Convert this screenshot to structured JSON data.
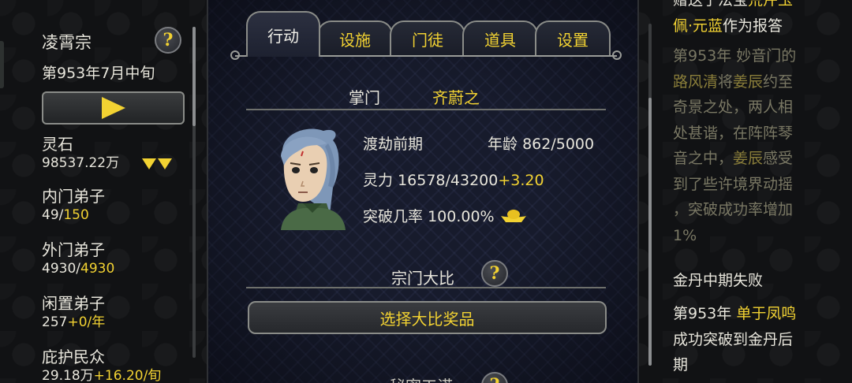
{
  "left": {
    "sect_name": "凌霄宗",
    "date": "第953年7月中旬",
    "stats": [
      {
        "label": "灵石",
        "value": "98537.22万",
        "extra": ""
      },
      {
        "label": "内门弟子",
        "value": "49/",
        "extra": "150"
      },
      {
        "label": "外门弟子",
        "value": "4930/",
        "extra": "4930"
      },
      {
        "label": "闲置弟子",
        "value": "257",
        "extra": "+0/年"
      },
      {
        "label": "庇护民众",
        "value": "29.18万",
        "extra": "+16.20/旬"
      }
    ]
  },
  "center": {
    "tabs": [
      "行动",
      "设施",
      "门徒",
      "道具",
      "设置"
    ],
    "master_label": "掌门",
    "master_name": "齐蔚之",
    "realm": "渡劫前期",
    "age_label": "年龄",
    "age_value": "862/5000",
    "spirit_label": "灵力",
    "spirit_value": "16578/43200",
    "spirit_rate": "+3.20",
    "breakthrough_label": "突破几率",
    "breakthrough_value": "100.00%",
    "competition_label": "宗门大比",
    "reward_button": "选择大比奖品",
    "partial_label": "秘密工诺"
  },
  "right": {
    "top_fragment_a": "赠送了法宝",
    "top_fragment_b": "荒芹玉",
    "top_line_item": "佩·元蓝",
    "top_line_rest": "作为报答",
    "dim_log_1": "第953年 妙音门的",
    "dim_log_name1": "路风清",
    "dim_log_2": "将",
    "dim_log_name2": "姜辰",
    "dim_log_3": "约至",
    "dim_log_4": "奇景之处，两人相",
    "dim_log_5": "处甚谐，在阵阵琴",
    "dim_log_6": "音之中，",
    "dim_log_name3": "姜辰",
    "dim_log_7": "感受",
    "dim_log_8": "到了些许境界动摇",
    "dim_log_9": "，突破成功率增加",
    "dim_log_10": "1%",
    "event_title": "金丹中期失败",
    "event_year": "第953年",
    "event_name": "单于凤鸣",
    "event_text_1": "成功突破到金丹后",
    "event_text_2": "期"
  },
  "colors": {
    "accent": "#f2d232",
    "text": "#e8e6dc",
    "panel": "#171b2c"
  }
}
